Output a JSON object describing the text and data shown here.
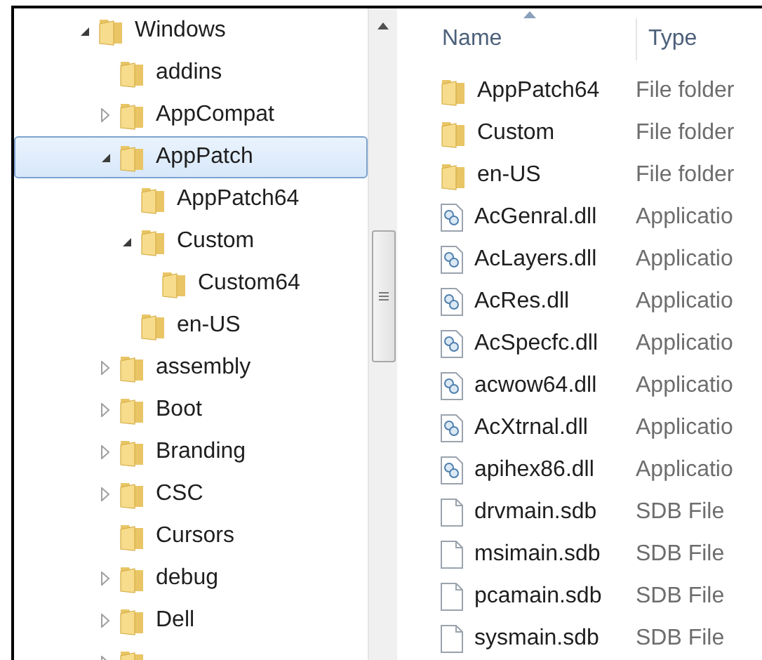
{
  "tree": [
    {
      "label": "Windows",
      "expanded": true,
      "selected": false,
      "children": [
        {
          "label": "addins",
          "selected": false
        },
        {
          "label": "AppCompat",
          "expanded": false,
          "selected": false
        },
        {
          "label": "AppPatch",
          "expanded": true,
          "selected": true,
          "children": [
            {
              "label": "AppPatch64",
              "selected": false
            },
            {
              "label": "Custom",
              "expanded": true,
              "selected": false,
              "children": [
                {
                  "label": "Custom64",
                  "selected": false
                }
              ]
            },
            {
              "label": "en-US",
              "selected": false
            }
          ]
        },
        {
          "label": "assembly",
          "expanded": false,
          "selected": false
        },
        {
          "label": "Boot",
          "expanded": false,
          "selected": false
        },
        {
          "label": "Branding",
          "expanded": false,
          "selected": false
        },
        {
          "label": "CSC",
          "expanded": false,
          "selected": false
        },
        {
          "label": "Cursors",
          "selected": false
        },
        {
          "label": "debug",
          "expanded": false,
          "selected": false
        },
        {
          "label": "Dell",
          "expanded": false,
          "selected": false
        },
        {
          "expanded": false,
          "selected": false
        }
      ]
    }
  ],
  "columns": [
    "Name",
    "Type"
  ],
  "files": [
    {
      "kind": "folder",
      "name": "AppPatch64",
      "type": "File folder"
    },
    {
      "kind": "folder",
      "name": "Custom",
      "type": "File folder"
    },
    {
      "kind": "folder",
      "name": "en-US",
      "type": "File folder"
    },
    {
      "kind": "dll",
      "name": "AcGenral.dll",
      "type": "Applicatio"
    },
    {
      "kind": "dll",
      "name": "AcLayers.dll",
      "type": "Applicatio"
    },
    {
      "kind": "dll",
      "name": "AcRes.dll",
      "type": "Applicatio"
    },
    {
      "kind": "dll",
      "name": "AcSpecfc.dll",
      "type": "Applicatio"
    },
    {
      "kind": "dll",
      "name": "acwow64.dll",
      "type": "Applicatio"
    },
    {
      "kind": "dll",
      "name": "AcXtrnal.dll",
      "type": "Applicatio"
    },
    {
      "kind": "dll",
      "name": "apihex86.dll",
      "type": "Applicatio"
    },
    {
      "kind": "file",
      "name": "drvmain.sdb",
      "type": "SDB File"
    },
    {
      "kind": "file",
      "name": "msimain.sdb",
      "type": "SDB File"
    },
    {
      "kind": "file",
      "name": "pcamain.sdb",
      "type": "SDB File"
    },
    {
      "kind": "file",
      "name": "sysmain.sdb",
      "type": "SDB File"
    }
  ]
}
